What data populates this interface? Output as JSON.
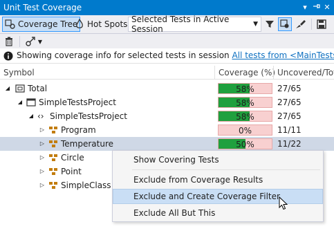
{
  "window": {
    "title": "Unit Test Coverage"
  },
  "toolbar": {
    "coverage_tree_label": "Coverage Tree",
    "hot_spots_label": "Hot Spots",
    "session_select_value": "Selected Tests in Active Session"
  },
  "info": {
    "text": "Showing coverage info for selected tests in session",
    "link": "All tests from <MainTests>"
  },
  "columns": {
    "symbol": "Symbol",
    "coverage": "Coverage (%)",
    "uncovered": "Uncovered/Tota"
  },
  "rows": [
    {
      "label": "Total",
      "coverage_pct": 58,
      "coverage_text": "58%",
      "uncovered": "27/65",
      "expanded": true,
      "icon": "assembly-icon",
      "level": 0
    },
    {
      "label": "SimpleTestsProject",
      "coverage_pct": 58,
      "coverage_text": "58%",
      "uncovered": "27/65",
      "expanded": true,
      "icon": "project-icon",
      "level": 1
    },
    {
      "label": "SimpleTestsProject",
      "coverage_pct": 58,
      "coverage_text": "58%",
      "uncovered": "27/65",
      "expanded": true,
      "icon": "namespace-icon",
      "level": 2
    },
    {
      "label": "Program",
      "coverage_pct": 0,
      "coverage_text": "0%",
      "uncovered": "11/11",
      "expanded": false,
      "icon": "class-icon",
      "level": 3
    },
    {
      "label": "Temperature",
      "coverage_pct": 50,
      "coverage_text": "50%",
      "uncovered": "11/22",
      "expanded": false,
      "icon": "class-icon",
      "level": 3
    },
    {
      "label": "Circle",
      "expanded": false,
      "icon": "class-icon",
      "level": 3
    },
    {
      "label": "Point",
      "expanded": false,
      "icon": "class-icon",
      "level": 3
    },
    {
      "label": "SimpleClass",
      "expanded": false,
      "icon": "class-icon",
      "level": 3
    }
  ],
  "context_menu": {
    "items": [
      "Show Covering Tests",
      "Exclude from Coverage Results",
      "Exclude and Create Coverage Filter",
      "Exclude All But This"
    ]
  },
  "colors": {
    "accent": "#007acc",
    "covered": "#1fa03e",
    "uncovered": "#f8d0d0",
    "link": "#0e70c0"
  }
}
